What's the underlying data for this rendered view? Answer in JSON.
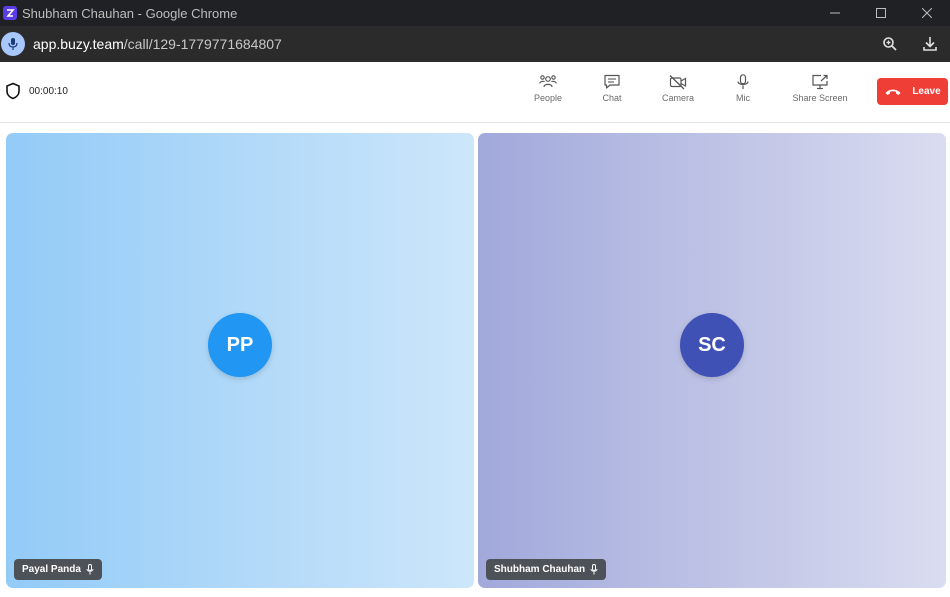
{
  "window": {
    "title": "Shubham Chauhan - Google Chrome"
  },
  "browser": {
    "url_host": "app.buzy.team",
    "url_path": "/call/129-1779771684807"
  },
  "call": {
    "timer": "00:00:10"
  },
  "toolbar": {
    "people_label": "People",
    "chat_label": "Chat",
    "camera_label": "Camera",
    "mic_label": "Mic",
    "share_label": "Share Screen",
    "leave_label": "Leave"
  },
  "participants": [
    {
      "initials": "PP",
      "name": "Payal Panda",
      "avatar_color": "#2196f3"
    },
    {
      "initials": "SC",
      "name": "Shubham Chauhan",
      "avatar_color": "#3f51b5"
    }
  ],
  "colors": {
    "leave": "#ef3e36",
    "titlebar": "#202124",
    "urlbar": "#2b2b2b"
  },
  "icons": [
    "app-icon",
    "minimize-icon",
    "maximize-icon",
    "close-icon",
    "mic-icon",
    "zoom-icon",
    "download-icon",
    "shield-icon",
    "people-icon",
    "chat-icon",
    "camera-off-icon",
    "mic-icon",
    "share-screen-icon",
    "phone-hangup-icon"
  ]
}
